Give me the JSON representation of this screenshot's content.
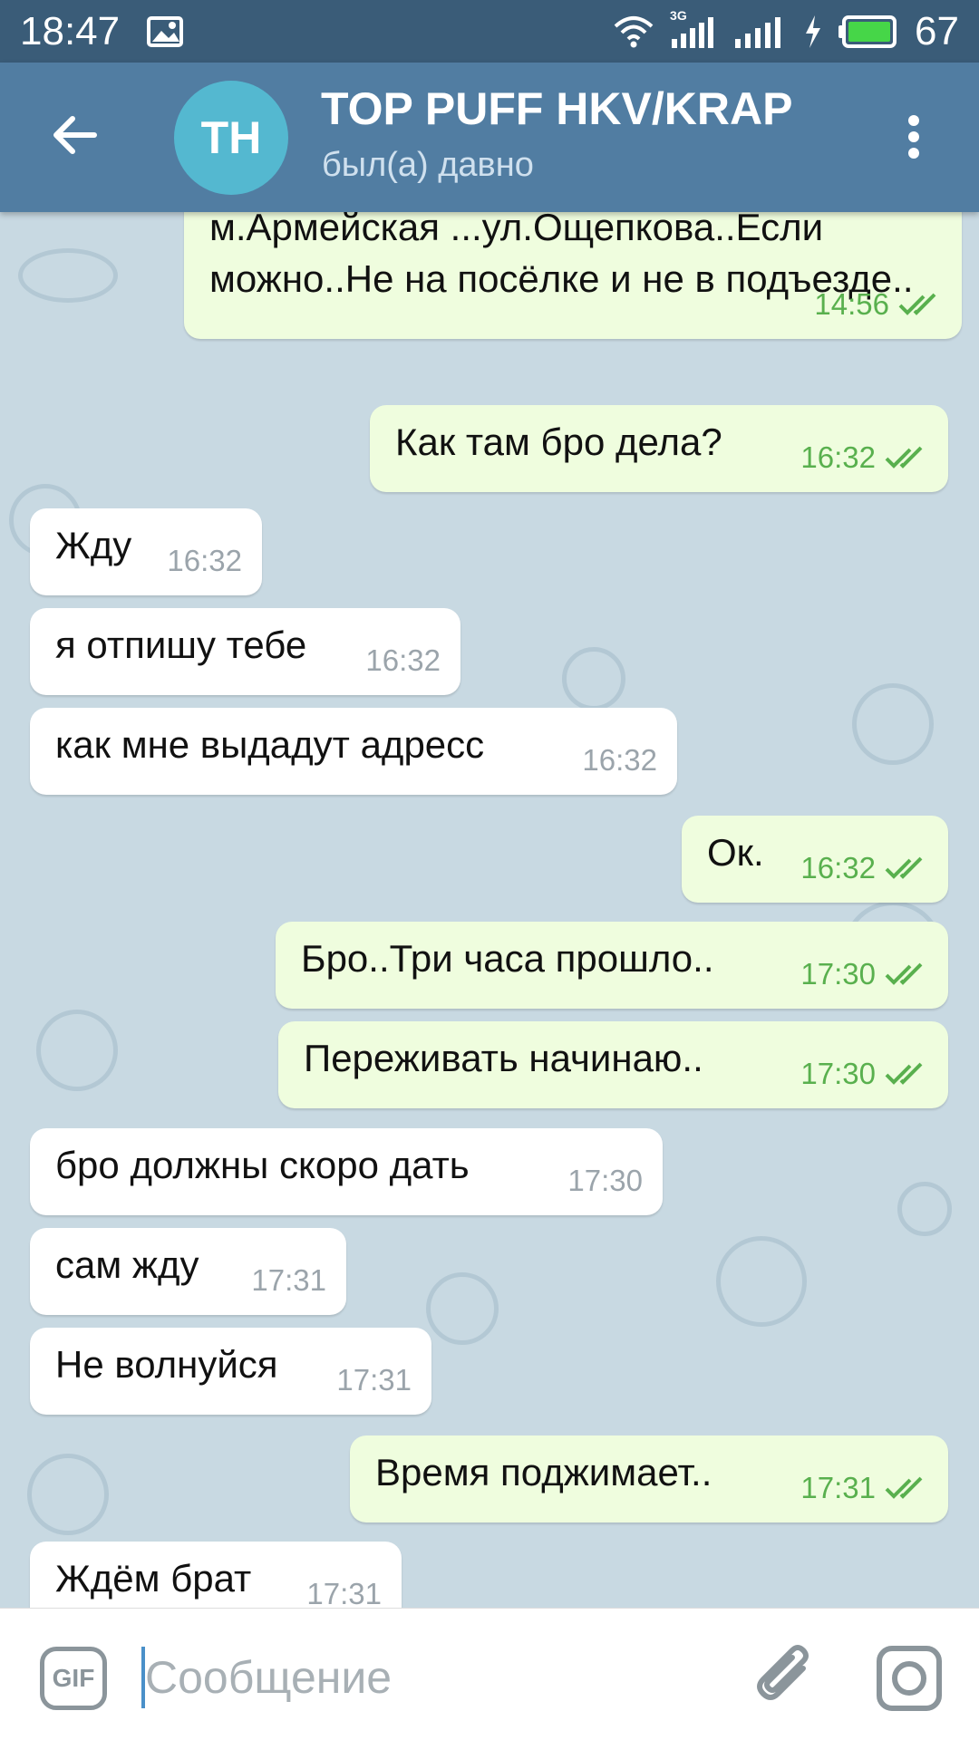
{
  "status_bar": {
    "time": "18:47",
    "network_label": "3G",
    "battery": "67",
    "battery_color": "#46d648",
    "icons": [
      "image-notification-icon",
      "wifi-icon",
      "signal-icon",
      "charging-icon",
      "battery-icon"
    ]
  },
  "header": {
    "avatar_initials": "TH",
    "avatar_color": "#54b8d0",
    "title": "TOP PUFF HKV/KRAP",
    "status": "был(а) давно",
    "accent_color": "#517da2"
  },
  "messages": [
    {
      "direction": "out",
      "text": "м.Армейская ...ул.Ощепкова..Если можно..Не на посёлке и не в подъезде..",
      "time": "14:56",
      "read": true
    },
    {
      "direction": "out",
      "text": "Как там бро дела?",
      "time": "16:32",
      "read": true
    },
    {
      "direction": "in",
      "text": "Жду",
      "time": "16:32"
    },
    {
      "direction": "in",
      "text": "я отпишу тебе",
      "time": "16:32"
    },
    {
      "direction": "in",
      "text": "как мне выдадут адресс",
      "time": "16:32"
    },
    {
      "direction": "out",
      "text": "Ок.",
      "time": "16:32",
      "read": true
    },
    {
      "direction": "out",
      "text": "Бро..Три часа прошло..",
      "time": "17:30",
      "read": true
    },
    {
      "direction": "out",
      "text": "Переживать начинаю..",
      "time": "17:30",
      "read": true
    },
    {
      "direction": "in",
      "text": "бро должны скоро дать",
      "time": "17:30"
    },
    {
      "direction": "in",
      "text": "сам жду",
      "time": "17:31"
    },
    {
      "direction": "in",
      "text": "Не волнуйся",
      "time": "17:31"
    },
    {
      "direction": "out",
      "text": "Время поджимает..",
      "time": "17:31",
      "read": true
    },
    {
      "direction": "in",
      "text": "Ждём брат",
      "time": "17:31"
    }
  ],
  "input": {
    "gif_label": "GIF",
    "placeholder": "Сообщение",
    "value": ""
  }
}
